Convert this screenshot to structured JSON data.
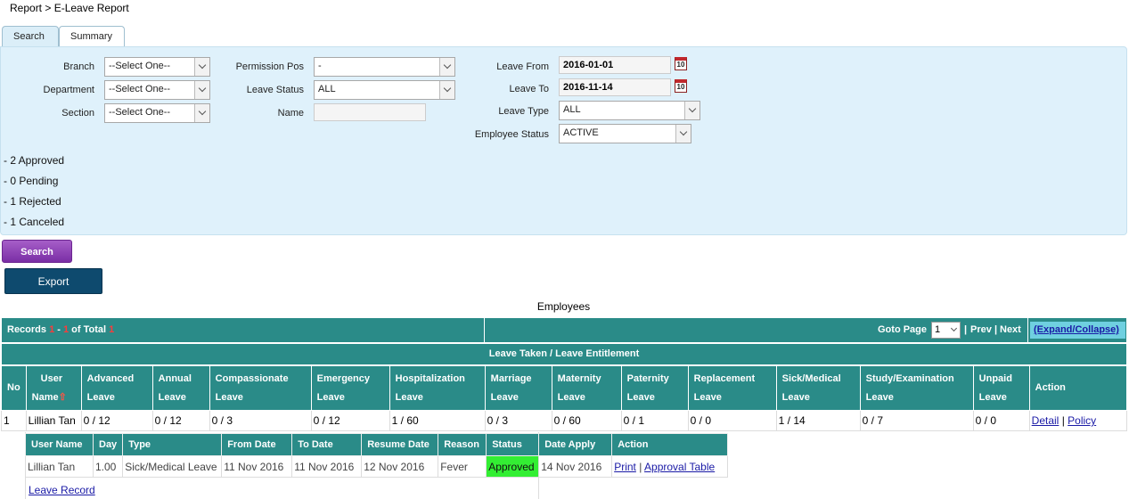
{
  "breadcrumb": "Report > E-Leave Report",
  "tabs": [
    {
      "label": "Search",
      "active": true
    },
    {
      "label": "Summary",
      "active": false
    }
  ],
  "filters": {
    "branch": {
      "label": "Branch",
      "value": "--Select One--"
    },
    "department": {
      "label": "Department",
      "value": "--Select One--"
    },
    "section": {
      "label": "Section",
      "value": "--Select One--"
    },
    "permission_pos": {
      "label": "Permission Pos",
      "value": "-"
    },
    "leave_status": {
      "label": "Leave Status",
      "value": "ALL"
    },
    "name": {
      "label": "Name",
      "value": ""
    },
    "leave_from": {
      "label": "Leave From",
      "value": "2016-01-01"
    },
    "leave_to": {
      "label": "Leave To",
      "value": "2016-11-14"
    },
    "leave_type": {
      "label": "Leave Type",
      "value": "ALL"
    },
    "employee_status": {
      "label": "Employee Status",
      "value": "ACTIVE"
    },
    "calendar_icon_text": "10"
  },
  "status_summary": [
    "- 2 Approved",
    "- 0 Pending",
    "- 1 Rejected",
    "- 1 Canceled"
  ],
  "buttons": {
    "search": "Search",
    "export": "Export"
  },
  "section_title": "Employees",
  "pager": {
    "records_prefix": "Records ",
    "records_from": "1",
    "records_sep": " - ",
    "records_to": "1",
    "records_mid": " of Total ",
    "records_total": "1",
    "goto_label": "Goto Page",
    "goto_value": "1",
    "prev": "Prev",
    "next": "Next",
    "sep": "|",
    "expand": "(Expand/Collapse)"
  },
  "band_title": "Leave Taken / Leave Entitlement",
  "columns": {
    "no": "No",
    "user": "User",
    "name": "Name",
    "types": [
      "Advanced",
      "Annual",
      "Compassionate",
      "Emergency",
      "Hospitalization",
      "Marriage",
      "Maternity",
      "Paternity",
      "Replacement",
      "Sick/Medical",
      "Study/Examination",
      "Unpaid"
    ],
    "leave": "Leave",
    "action": "Action"
  },
  "row": {
    "no": "1",
    "user_name": "Lillian Tan",
    "values": [
      "0 / 12",
      "0 / 12",
      "0 / 3",
      "0 / 12",
      "1 / 60",
      "0 / 3",
      "0 / 60",
      "0 / 1",
      "0 / 0",
      "1 / 14",
      "0 / 7",
      "0 / 0"
    ],
    "detail": "Detail",
    "policy": "Policy",
    "sep": "|"
  },
  "sub_table": {
    "headers": [
      "User Name",
      "Day",
      "Type",
      "From Date",
      "To Date",
      "Resume Date",
      "Reason",
      "Status",
      "Date Apply",
      "Action"
    ],
    "row": {
      "user_name": "Lillian Tan",
      "day": "1.00",
      "type": "Sick/Medical Leave",
      "from_date": "11 Nov 2016",
      "to_date": "11 Nov 2016",
      "resume_date": "12 Nov 2016",
      "reason": "Fever",
      "status": "Approved",
      "date_apply": "14 Nov 2016",
      "print": "Print",
      "approval_table": "Approval Table",
      "sep": "|"
    },
    "leave_record": "Leave Record"
  },
  "colors": {
    "teal": "#2a8b88",
    "panel": "#dff1fb",
    "approved": "#33ee33",
    "search_btn": "#8b3bb5",
    "export_btn": "#0e4a6e"
  }
}
